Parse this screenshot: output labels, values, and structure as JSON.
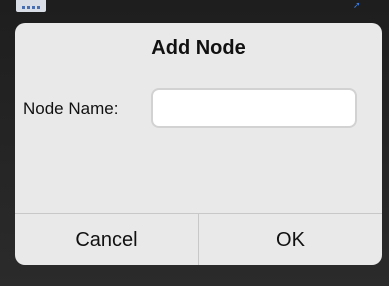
{
  "dialog": {
    "title": "Add Node",
    "field_label": "Node Name:",
    "field_value": "",
    "field_placeholder": "",
    "cancel_label": "Cancel",
    "ok_label": "OK"
  },
  "colors": {
    "background": "#262626",
    "dialog": "#e9e9e9",
    "divider": "#c8c8c8",
    "text": "#111111"
  },
  "icons": {
    "top_left": "app-thumbnail-icon",
    "top_right": "arrow-icon"
  }
}
